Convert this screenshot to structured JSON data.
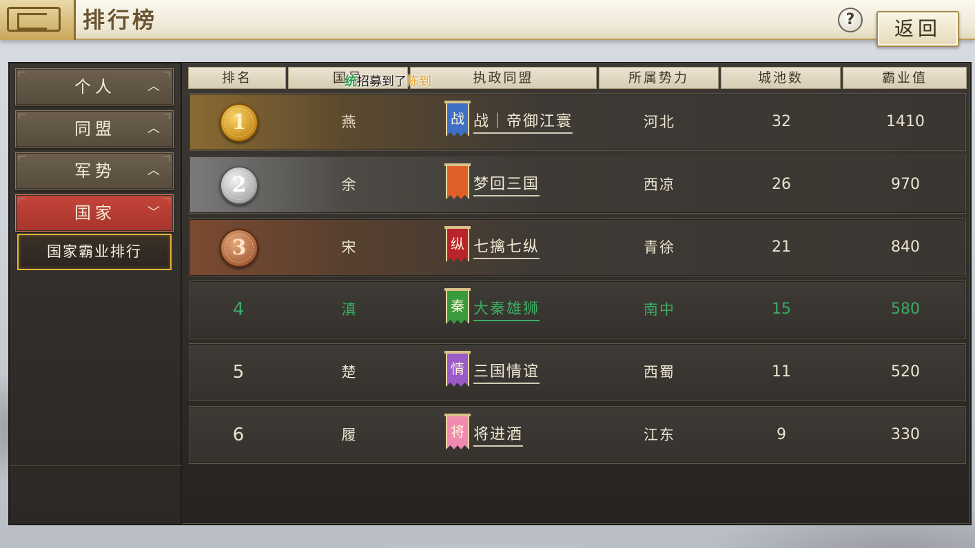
{
  "header": {
    "title": "排行榜",
    "help_label": "?",
    "back_label": "返回"
  },
  "sidebar": {
    "items": [
      {
        "label": "个人",
        "arrow": "up-chevron",
        "active": false
      },
      {
        "label": "同盟",
        "arrow": "up-chevron",
        "active": false
      },
      {
        "label": "军势",
        "arrow": "up-chevron",
        "active": false
      },
      {
        "label": "国家",
        "arrow": "down-chevron",
        "active": true
      }
    ],
    "sub_item": "国家霸业排行"
  },
  "table": {
    "headers": [
      "排名",
      "国号",
      "执政同盟",
      "所属势力",
      "城池数",
      "霸业值"
    ],
    "rows": [
      {
        "rank": "1",
        "medal": "gold",
        "country": "燕",
        "banner_char": "战",
        "banner_color": "#3d6fc4",
        "alliance": "战｜帝御江寰",
        "region": "河北",
        "cities": "32",
        "score": "1410"
      },
      {
        "rank": "2",
        "medal": "silver",
        "country": "余",
        "banner_char": "",
        "banner_color": "#e0602a",
        "alliance": "梦回三国",
        "region": "西凉",
        "cities": "26",
        "score": "970"
      },
      {
        "rank": "3",
        "medal": "bronze",
        "country": "宋",
        "banner_char": "纵",
        "banner_color": "#b8242a",
        "alliance": "七擒七纵",
        "region": "青徐",
        "cities": "21",
        "score": "840"
      },
      {
        "rank": "4",
        "medal": "",
        "country": "滇",
        "banner_char": "秦",
        "banner_color": "#3a9a3e",
        "alliance": "大秦雄狮",
        "region": "南中",
        "cities": "15",
        "score": "580",
        "highlight": "green"
      },
      {
        "rank": "5",
        "medal": "",
        "country": "楚",
        "banner_char": "情",
        "banner_color": "#9a5ac8",
        "alliance": "三国情谊",
        "region": "西蜀",
        "cities": "11",
        "score": "520"
      },
      {
        "rank": "6",
        "medal": "",
        "country": "履",
        "banner_char": "将",
        "banner_color": "#f08ab0",
        "alliance": "将进酒",
        "region": "江东",
        "cities": "9",
        "score": "330"
      }
    ]
  },
  "notice": {
    "icon_text": "统",
    "text": "招募到了",
    "name": "陈到"
  },
  "colors": {
    "highlight_green": "#3cab62",
    "active_tab_red": "#c4453a",
    "sub_item_gold": "#e3b43a"
  }
}
